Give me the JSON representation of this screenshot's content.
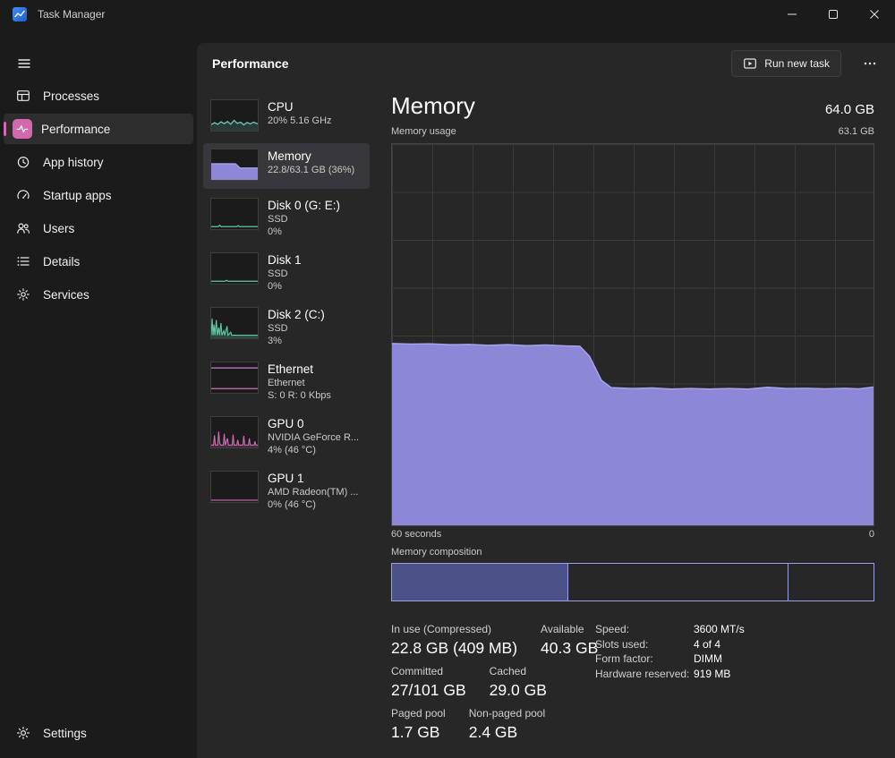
{
  "colors": {
    "accent_pink": "#d269ae",
    "memory_purple_fill": "#8d87d8",
    "memory_purple_line": "#aba5ef",
    "composition_fill": "#4c5288",
    "composition_border": "#9ba0e4",
    "cpu_teal": "#6cc7bd",
    "disk_green": "#63c8a8",
    "gpu_pink": "#d06cb4"
  },
  "titlebar": {
    "title": "Task Manager"
  },
  "sidebar": {
    "items": [
      {
        "label": "Processes",
        "icon": "processes-icon",
        "selected": false
      },
      {
        "label": "Performance",
        "icon": "performance-icon",
        "selected": true
      },
      {
        "label": "App history",
        "icon": "app-history-icon",
        "selected": false
      },
      {
        "label": "Startup apps",
        "icon": "startup-apps-icon",
        "selected": false
      },
      {
        "label": "Users",
        "icon": "users-icon",
        "selected": false
      },
      {
        "label": "Details",
        "icon": "details-icon",
        "selected": false
      },
      {
        "label": "Services",
        "icon": "services-icon",
        "selected": false
      }
    ],
    "settings_label": "Settings"
  },
  "header": {
    "title": "Performance",
    "run_new_task_label": "Run new task"
  },
  "perf_list": [
    {
      "name": "CPU",
      "sub1": "20% 5.16 GHz"
    },
    {
      "name": "Memory",
      "sub1": "22.8/63.1 GB (36%)"
    },
    {
      "name": "Disk 0 (G: E:)",
      "sub1": "SSD",
      "sub2": "0%"
    },
    {
      "name": "Disk 1",
      "sub1": "SSD",
      "sub2": "0%"
    },
    {
      "name": "Disk 2 (C:)",
      "sub1": "SSD",
      "sub2": "3%"
    },
    {
      "name": "Ethernet",
      "sub1": "Ethernet",
      "sub2": "S: 0 R: 0 Kbps"
    },
    {
      "name": "GPU 0",
      "sub1": "NVIDIA GeForce R...",
      "sub2": "4% (46 °C)"
    },
    {
      "name": "GPU 1",
      "sub1": "AMD Radeon(TM) ...",
      "sub2": "0% (46 °C)"
    }
  ],
  "memory": {
    "title": "Memory",
    "total": "64.0 GB",
    "usage_label": "Memory usage",
    "scale_max_label": "63.1 GB",
    "x_left_label": "60 seconds",
    "x_right_label": "0",
    "composition_label": "Memory composition",
    "stats": {
      "in_use_label": "In use (Compressed)",
      "in_use_value": "22.8 GB (409 MB)",
      "available_label": "Available",
      "available_value": "40.3 GB",
      "committed_label": "Committed",
      "committed_value": "27/101 GB",
      "cached_label": "Cached",
      "cached_value": "29.0 GB",
      "paged_label": "Paged pool",
      "paged_value": "1.7 GB",
      "nonpaged_label": "Non-paged pool",
      "nonpaged_value": "2.4 GB"
    },
    "details": [
      {
        "label": "Speed:",
        "value": "3600 MT/s"
      },
      {
        "label": "Slots used:",
        "value": "4 of 4"
      },
      {
        "label": "Form factor:",
        "value": "DIMM"
      },
      {
        "label": "Hardware reserved:",
        "value": "919 MB"
      }
    ]
  },
  "chart_data": {
    "type": "area",
    "title": "Memory usage",
    "ylabel": "GB",
    "ylim": [
      0,
      63.1
    ],
    "x_range_seconds": [
      60,
      0
    ],
    "grid": {
      "v_divisions": 12,
      "h_divisions": 8
    },
    "points": [
      [
        0.0,
        30.1
      ],
      [
        0.04,
        30.0
      ],
      [
        0.08,
        30.05
      ],
      [
        0.12,
        29.9
      ],
      [
        0.16,
        29.95
      ],
      [
        0.2,
        29.8
      ],
      [
        0.24,
        29.9
      ],
      [
        0.28,
        29.75
      ],
      [
        0.32,
        29.85
      ],
      [
        0.36,
        29.7
      ],
      [
        0.39,
        29.65
      ],
      [
        0.41,
        28.0
      ],
      [
        0.435,
        24.0
      ],
      [
        0.455,
        22.8
      ],
      [
        0.5,
        22.65
      ],
      [
        0.54,
        22.75
      ],
      [
        0.58,
        22.55
      ],
      [
        0.62,
        22.65
      ],
      [
        0.66,
        22.55
      ],
      [
        0.7,
        22.65
      ],
      [
        0.74,
        22.55
      ],
      [
        0.78,
        22.85
      ],
      [
        0.82,
        22.65
      ],
      [
        0.86,
        22.7
      ],
      [
        0.9,
        22.6
      ],
      [
        0.94,
        22.7
      ],
      [
        0.97,
        22.6
      ],
      [
        1.0,
        22.9
      ]
    ],
    "composition_segments": [
      {
        "name": "in_use",
        "pct": 36.6
      },
      {
        "name": "standby",
        "pct": 45.8
      },
      {
        "name": "free",
        "pct": 17.6
      }
    ]
  }
}
